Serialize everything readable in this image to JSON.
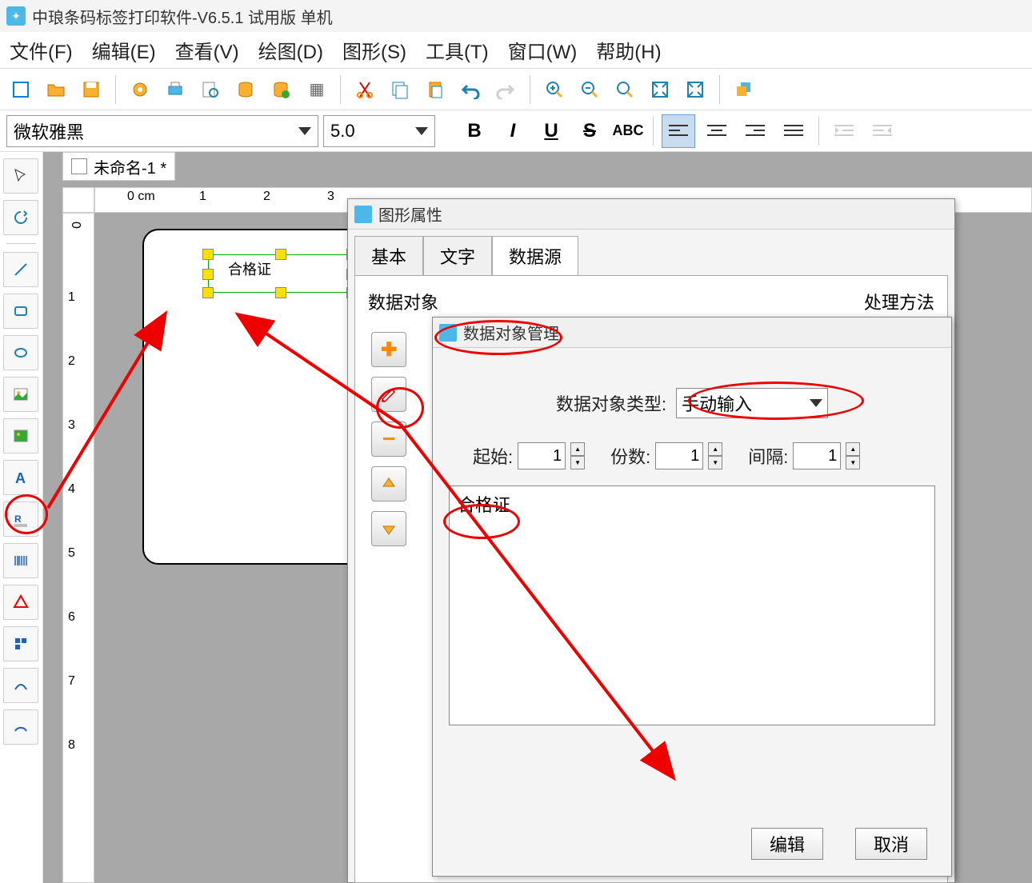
{
  "app": {
    "title": "中琅条码标签打印软件-V6.5.1 试用版 单机"
  },
  "menu": {
    "file": "文件(F)",
    "edit": "编辑(E)",
    "view": "查看(V)",
    "draw": "绘图(D)",
    "shape": "图形(S)",
    "tool": "工具(T)",
    "window": "窗口(W)",
    "help": "帮助(H)"
  },
  "format": {
    "font": "微软雅黑",
    "size": "5.0",
    "bold": "B",
    "italic": "I",
    "underline": "U",
    "strike": "S"
  },
  "document": {
    "tab_name": "未命名-1 *",
    "ruler_label": "0 cm",
    "selected_text": "合格证"
  },
  "dialog1": {
    "title": "图形属性",
    "tab_basic": "基本",
    "tab_text": "文字",
    "tab_data": "数据源",
    "section_obj": "数据对象",
    "section_method": "处理方法"
  },
  "dialog2": {
    "title": "数据对象管理",
    "type_label": "数据对象类型:",
    "type_value": "手动输入",
    "start_label": "起始:",
    "start_value": "1",
    "count_label": "份数:",
    "count_value": "1",
    "gap_label": "间隔:",
    "gap_value": "1",
    "content": "合格证",
    "btn_edit": "编辑",
    "btn_cancel": "取消"
  }
}
